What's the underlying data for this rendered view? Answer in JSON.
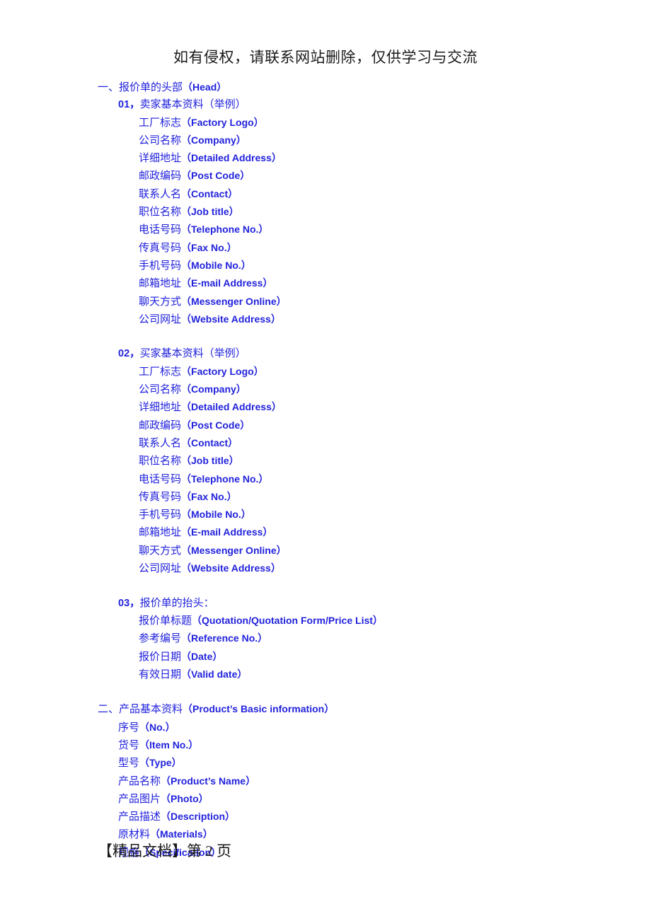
{
  "notice": "如有侵权，请联系网站删除，仅供学习与交流",
  "footer": "【精品文档】第 2 页",
  "colors": {
    "outline_text": "#2222dd",
    "plain_text": "#1a1a1a",
    "page_background": "#ffffff"
  },
  "outline": [
    {
      "level": 1,
      "zh": "一、报价单的头部",
      "lat": "（Head）"
    },
    {
      "level": 2,
      "num": "01，",
      "zh": "卖家基本资料（举例）",
      "lat": ""
    },
    {
      "level": 3,
      "zh": "工厂标志",
      "lat": "（Factory Logo）"
    },
    {
      "level": 3,
      "zh": "公司名称",
      "lat": "（Company）"
    },
    {
      "level": 3,
      "zh": "详细地址",
      "lat": "（Detailed Address）"
    },
    {
      "level": 3,
      "zh": "邮政编码",
      "lat": "（Post Code）"
    },
    {
      "level": 3,
      "zh": "联系人名",
      "lat": "（Contact）"
    },
    {
      "level": 3,
      "zh": "职位名称",
      "lat": "（Job title）"
    },
    {
      "level": 3,
      "zh": "电话号码",
      "lat": "（Telephone No.）"
    },
    {
      "level": 3,
      "zh": "传真号码",
      "lat": "（Fax No.）"
    },
    {
      "level": 3,
      "zh": "手机号码",
      "lat": "（Mobile No.）"
    },
    {
      "level": 3,
      "zh": "邮箱地址",
      "lat": "（E-mail Address）"
    },
    {
      "level": 3,
      "zh": "聊天方式",
      "lat": "（Messenger Online）"
    },
    {
      "level": 3,
      "zh": "公司网址",
      "lat": "（Website Address）"
    },
    {
      "level": 0,
      "zh": "",
      "lat": ""
    },
    {
      "level": 2,
      "num": "02，",
      "zh": "买家基本资料（举例）",
      "lat": ""
    },
    {
      "level": 3,
      "zh": "工厂标志",
      "lat": "（Factory Logo）"
    },
    {
      "level": 3,
      "zh": "公司名称",
      "lat": "（Company）"
    },
    {
      "level": 3,
      "zh": "详细地址",
      "lat": "（Detailed Address）"
    },
    {
      "level": 3,
      "zh": "邮政编码",
      "lat": "（Post Code）"
    },
    {
      "level": 3,
      "zh": "联系人名",
      "lat": "（Contact）"
    },
    {
      "level": 3,
      "zh": "职位名称",
      "lat": "（Job title）"
    },
    {
      "level": 3,
      "zh": "电话号码",
      "lat": "（Telephone No.）"
    },
    {
      "level": 3,
      "zh": "传真号码",
      "lat": "（Fax No.）"
    },
    {
      "level": 3,
      "zh": "手机号码",
      "lat": "（Mobile No.）"
    },
    {
      "level": 3,
      "zh": "邮箱地址",
      "lat": "（E-mail Address）"
    },
    {
      "level": 3,
      "zh": "聊天方式",
      "lat": "（Messenger Online）"
    },
    {
      "level": 3,
      "zh": "公司网址",
      "lat": "（Website Address）"
    },
    {
      "level": 0,
      "zh": "",
      "lat": ""
    },
    {
      "level": 2,
      "num": "03，",
      "zh": "报价单的抬头：",
      "lat": ""
    },
    {
      "level": 3,
      "zh": "报价单标题",
      "lat": "（Quotation/Quotation Form/Price List）"
    },
    {
      "level": 3,
      "zh": "参考编号",
      "lat": "（Reference No.）"
    },
    {
      "level": 3,
      "zh": "报价日期",
      "lat": "（Date）"
    },
    {
      "level": 3,
      "zh": "有效日期",
      "lat": "（Valid date）"
    },
    {
      "level": 0,
      "zh": "",
      "lat": ""
    },
    {
      "level": 1,
      "zh": "二、产品基本资料",
      "lat": "（Product’s Basic information）"
    },
    {
      "level": 2,
      "zh": "序号",
      "lat": "（No.）"
    },
    {
      "level": 2,
      "zh": "货号",
      "lat": "（Item No.）"
    },
    {
      "level": 2,
      "zh": "型号",
      "lat": "（Type）"
    },
    {
      "level": 2,
      "zh": "产品名称",
      "lat": "（Product’s Name）"
    },
    {
      "level": 2,
      "zh": "产品图片",
      "lat": "（Photo）"
    },
    {
      "level": 2,
      "zh": "产品描述",
      "lat": "（Description）"
    },
    {
      "level": 2,
      "zh": "原材料",
      "lat": "（Materials）"
    },
    {
      "level": 2,
      "zh": "规格",
      "lat": "（Specification）"
    }
  ]
}
